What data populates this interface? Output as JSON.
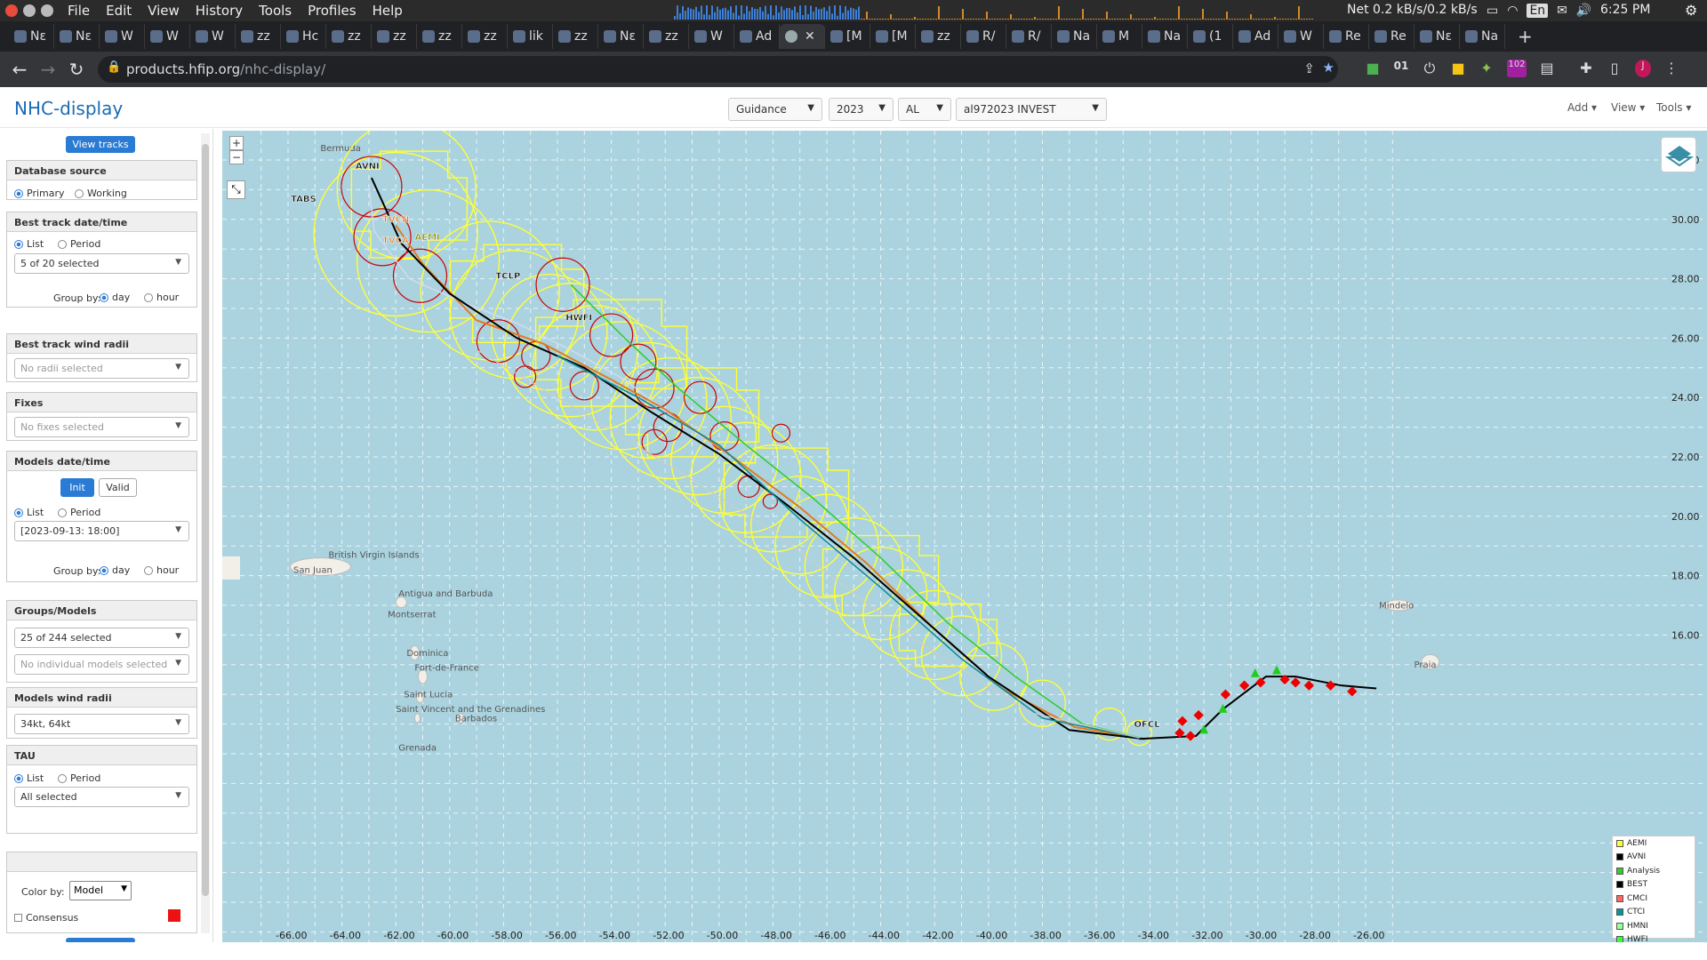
{
  "os": {
    "menus": [
      "File",
      "Edit",
      "View",
      "History",
      "Tools",
      "Profiles",
      "Help"
    ],
    "net": "Net 0.2 kB/s/0.2 kB/s",
    "lang": "En",
    "time": "6:25 PM"
  },
  "tabs": [
    "Nε",
    "Nε",
    "W",
    "W",
    "W",
    "zz",
    "Hc",
    "zz",
    "zz",
    "zz",
    "zz",
    "lik",
    "zz",
    "Nε",
    "zz",
    "W",
    "Ad",
    "",
    "[M",
    "[M",
    "zz",
    "R/",
    "R/",
    "Na",
    "M",
    "Na",
    "(1",
    "Ad",
    "W",
    "Re",
    "Re",
    "Nε",
    "Na"
  ],
  "active_tab_index": 17,
  "browser": {
    "url_host": "products.hfip.org",
    "url_path": "/nhc-display/",
    "ext_badge": "102",
    "ext_text": "01",
    "profile": "J"
  },
  "app": {
    "title": "NHC-display",
    "selectors": {
      "guidance": "Guidance",
      "year": "2023",
      "basin": "AL",
      "storm": "al972023 INVEST"
    },
    "right_menus": [
      "Add",
      "View",
      "Tools"
    ]
  },
  "sidebar": {
    "view_tracks": "View tracks",
    "db_source": {
      "title": "Database source",
      "opt1": "Primary",
      "opt2": "Working"
    },
    "best_track": {
      "title": "Best track date/time",
      "opt1": "List",
      "opt2": "Period",
      "selected": "5 of 20 selected",
      "group_by": "Group by:",
      "g1": "day",
      "g2": "hour"
    },
    "bt_wind_radii": {
      "title": "Best track wind radii",
      "placeholder": "No radii selected"
    },
    "fixes": {
      "title": "Fixes",
      "placeholder": "No fixes selected"
    },
    "models_dt": {
      "title": "Models date/time",
      "init": "Init",
      "valid": "Valid",
      "opt1": "List",
      "opt2": "Period",
      "selected": "[2023-09-13: 18:00]",
      "group_by": "Group by:",
      "g1": "day",
      "g2": "hour"
    },
    "groups": {
      "title": "Groups/Models",
      "selected": "25 of 244 selected",
      "individual": "No individual models selected"
    },
    "model_radii": {
      "title": "Models wind radii",
      "selected": "34kt, 64kt"
    },
    "tau": {
      "title": "TAU",
      "opt1": "List",
      "opt2": "Period",
      "selected": "All selected"
    },
    "color_by": {
      "label": "Color by:",
      "value": "Model",
      "consensus": "Consensus"
    }
  },
  "map": {
    "lon_labels": [
      "-66.00",
      "-64.00",
      "-62.00",
      "-60.00",
      "-58.00",
      "-56.00",
      "-54.00",
      "-52.00",
      "-50.00",
      "-48.00",
      "-46.00",
      "-44.00",
      "-42.00",
      "-40.00",
      "-38.00",
      "-36.00",
      "-34.00",
      "-32.00",
      "-30.00",
      "-28.00",
      "-26.00"
    ],
    "lat_labels": [
      "32.00",
      "30.00",
      "28.00",
      "26.00",
      "24.00",
      "22.00",
      "20.00",
      "18.00",
      "16.00"
    ],
    "places": [
      "Bermuda",
      "San Juan",
      "British Virgin Islands",
      "Antigua and Barbuda",
      "Montserrat",
      "Dominica",
      "Fort-de-France",
      "Saint Lucia",
      "Saint Vincent and the Grenadines",
      "Barbados",
      "Grenada",
      "Mindelo",
      "Praia"
    ],
    "model_labels": [
      "AVNI",
      "TVCN",
      "TVCA",
      "AEMI",
      "TCLP",
      "HWFI",
      "TABS",
      "OFCL"
    ],
    "colors": {
      "ocean": "#aad3df",
      "land": "#f2efe9",
      "radii_yellow": "#ffff33",
      "radii_red": "#cc0000"
    }
  },
  "legend": [
    {
      "name": "AEMI",
      "color": "#ffff33"
    },
    {
      "name": "AVNI",
      "color": "#000000"
    },
    {
      "name": "Analysis",
      "color": "#33cc33"
    },
    {
      "name": "BEST",
      "color": "#000000"
    },
    {
      "name": "CMCI",
      "color": "#ff6666"
    },
    {
      "name": "CTCI",
      "color": "#009999"
    },
    {
      "name": "HMNI",
      "color": "#99ff99"
    },
    {
      "name": "HWFI",
      "color": "#33ff33"
    }
  ]
}
